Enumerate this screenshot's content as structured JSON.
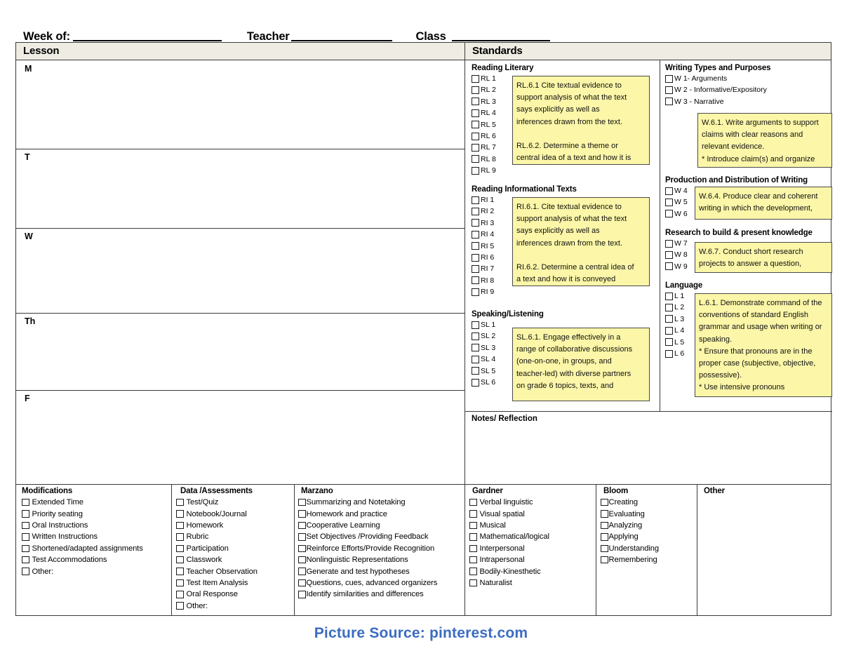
{
  "form": {
    "week_label": "Week of:",
    "teacher_label": "Teacher",
    "class_label": "Class"
  },
  "table_headers": {
    "lesson": "Lesson",
    "standards": "Standards"
  },
  "days": [
    "M",
    "T",
    "W",
    "Th",
    "F"
  ],
  "notes": {
    "title": "Notes/ Reflection"
  },
  "standards": {
    "left_groups": [
      {
        "title": "Reading Literary",
        "items": [
          "RL 1",
          "RL 2",
          "RL 3",
          "RL 4",
          "RL 5",
          "RL 6",
          "RL 7",
          "RL 8",
          "RL 9"
        ],
        "sticky": [
          "RL.6.1 Cite textual evidence to",
          "support analysis of what the text",
          "says explicitly as well as",
          "inferences drawn from the text.",
          "",
          "RL.6.2. Determine a theme or",
          "central idea of a text and how it is"
        ]
      },
      {
        "title": "Reading Informational Texts",
        "items": [
          "RI 1",
          "RI 2",
          "RI 3",
          "RI 4",
          "RI 5",
          "RI 6",
          "RI 7",
          "RI 8",
          "RI 9"
        ],
        "sticky": [
          "RI.6.1. Cite textual evidence to",
          "support analysis of what the text",
          "says explicitly as well as",
          "inferences drawn from the text.",
          "",
          "RI.6.2. Determine a central idea of",
          "a text and how it is conveyed"
        ]
      },
      {
        "title": "Speaking/Listening",
        "items": [
          "SL 1",
          "SL 2",
          "SL 3",
          "SL 4",
          "SL 5",
          "SL 6"
        ],
        "sticky": [
          "SL.6.1. Engage effectively in a",
          "range of collaborative discussions",
          "(one-on-one, in groups, and",
          "teacher-led) with diverse partners",
          "on grade 6 topics, texts, and"
        ]
      }
    ],
    "right_groups": [
      {
        "title": "Writing Types and Purposes",
        "items": [
          "W 1- Arguments",
          "W 2 - Informative/Expository",
          "W 3 - Narrative"
        ],
        "sticky": [
          "W.6.1. Write arguments to support",
          "claims with clear reasons and",
          "relevant evidence.",
          "*  Introduce claim(s) and organize"
        ]
      },
      {
        "title": "Production and Distribution of Writing",
        "items": [
          "W 4",
          "W 5",
          "W 6"
        ],
        "sticky": [
          "W.6.4. Produce clear and coherent",
          "writing in which the development,"
        ]
      },
      {
        "title": "Research to build & present knowledge",
        "items": [
          "W 7",
          "W 8",
          "W 9"
        ],
        "sticky": [
          "W.6.7. Conduct short research",
          "projects to answer a question,"
        ]
      },
      {
        "title": "Language",
        "items": [
          "L 1",
          "L 2",
          "L 3",
          "L 4",
          "L 5",
          "L 6"
        ],
        "sticky": [
          "L.6.1. Demonstrate command of the",
          "conventions of standard English",
          "grammar and usage when writing or",
          "speaking.",
          "*  Ensure that pronouns are in the",
          "proper case (subjective, objective,",
          "possessive).",
          "*  Use intensive pronouns"
        ]
      }
    ]
  },
  "bottom": {
    "modifications": {
      "title": "Modifications",
      "items": [
        "Extended Time",
        "Priority seating",
        "Oral Instructions",
        "Written Instructions",
        "Shortened/adapted assignments",
        "Test Accommodations",
        "Other:"
      ]
    },
    "data_assessments": {
      "title": "Data /Assessments",
      "items": [
        "Test/Quiz",
        "Notebook/Journal",
        "Homework",
        "Rubric",
        "Participation",
        "Classwork",
        "Teacher Observation",
        "Test Item Analysis",
        "Oral Response",
        "Other:"
      ]
    },
    "marzano": {
      "title": "Marzano",
      "items": [
        "Summarizing and Notetaking",
        "Homework and practice",
        "Cooperative Learning",
        "Set Objectives /Providing Feedback",
        "Reinforce Efforts/Provide Recognition",
        "Nonlinguistic Representations",
        "Generate and test hypotheses",
        "Questions, cues, advanced organizers",
        "Identify similarities and differences"
      ]
    },
    "gardner": {
      "title": "Gardner",
      "items": [
        "Verbal linguistic",
        "Visual spatial",
        "Musical",
        "Mathematical/logical",
        "Interpersonal",
        "Intrapersonal",
        "Bodily-Kinesthetic",
        "Naturalist"
      ]
    },
    "bloom": {
      "title": "Bloom",
      "items": [
        "Creating",
        "Evaluating",
        "Analyzing",
        "Applying",
        "Understanding",
        "Remembering"
      ]
    },
    "other": {
      "title": "Other",
      "items": []
    }
  },
  "caption": "Picture Source: pinterest.com",
  "colors": {
    "header_band": "#efece3",
    "sticky_note": "#fbf6a8",
    "border": "#3a3a3a",
    "caption_blue": "#3b6cc1"
  }
}
